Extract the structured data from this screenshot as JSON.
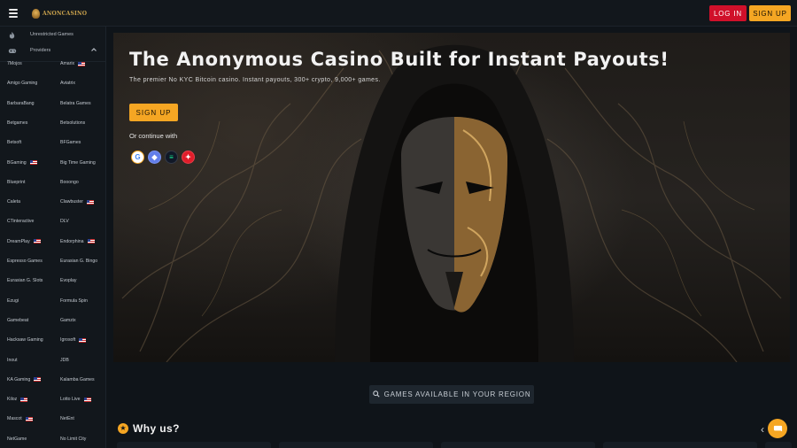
{
  "header": {
    "logo_text": "ANONCASINO",
    "login_label": "LOG IN",
    "signup_label": "SIGN UP"
  },
  "sidebar": {
    "unrestricted_label": "Unrestricted Games",
    "providers_label": "Providers",
    "providers": [
      {
        "name": "7Mojos",
        "flag": false
      },
      {
        "name": "Amarix",
        "flag": true
      },
      {
        "name": "Amigo Gaming",
        "flag": false
      },
      {
        "name": "Aviatrix",
        "flag": false
      },
      {
        "name": "BarbaraBang",
        "flag": false
      },
      {
        "name": "Belatra Games",
        "flag": false
      },
      {
        "name": "Betgames",
        "flag": false
      },
      {
        "name": "Betsolutions",
        "flag": false
      },
      {
        "name": "Betsoft",
        "flag": false
      },
      {
        "name": "BFGames",
        "flag": false
      },
      {
        "name": "BGaming",
        "flag": true
      },
      {
        "name": "Big Time Gaming",
        "flag": false
      },
      {
        "name": "Blueprint",
        "flag": false
      },
      {
        "name": "Booongo",
        "flag": false
      },
      {
        "name": "Caleta",
        "flag": false
      },
      {
        "name": "Clawbuster",
        "flag": true
      },
      {
        "name": "CTinteractive",
        "flag": false
      },
      {
        "name": "DLV",
        "flag": false
      },
      {
        "name": "DreamPlay",
        "flag": true
      },
      {
        "name": "Endorphina",
        "flag": true
      },
      {
        "name": "Espresso Games",
        "flag": false
      },
      {
        "name": "Eurasian G. Bingo",
        "flag": false
      },
      {
        "name": "Eurasian G. Slots",
        "flag": false
      },
      {
        "name": "Evoplay",
        "flag": false
      },
      {
        "name": "Ezugi",
        "flag": false
      },
      {
        "name": "Formula Spin",
        "flag": false
      },
      {
        "name": "Gamebeat",
        "flag": false
      },
      {
        "name": "Gamzix",
        "flag": false
      },
      {
        "name": "Hacksaw Gaming",
        "flag": false
      },
      {
        "name": "Igrosoft",
        "flag": true
      },
      {
        "name": "Inout",
        "flag": false
      },
      {
        "name": "JDB",
        "flag": false
      },
      {
        "name": "KA Gaming",
        "flag": true
      },
      {
        "name": "Kalamba Games",
        "flag": false
      },
      {
        "name": "Kiloz",
        "flag": true
      },
      {
        "name": "Lotto Live",
        "flag": true
      },
      {
        "name": "Mascot",
        "flag": true
      },
      {
        "name": "NetEnt",
        "flag": false
      },
      {
        "name": "NetGame",
        "flag": false
      },
      {
        "name": "No Limit City",
        "flag": false
      }
    ]
  },
  "hero": {
    "title": "The Anonymous Casino Built for Instant Payouts!",
    "subtitle": "The premier No KYC Bitcoin casino. Instant payouts, 300+ crypto, 9,000+ games.",
    "signup_label": "SIGN UP",
    "continue_label": "Or continue with",
    "social": [
      {
        "name": "google",
        "glyph": "G",
        "bg": "#ffffff",
        "fg": "#4285f4"
      },
      {
        "name": "ethereum",
        "glyph": "◆",
        "bg": "#627eea",
        "fg": "#ffffff"
      },
      {
        "name": "solana",
        "glyph": "≡",
        "bg": "#111827",
        "fg": "#14f195"
      },
      {
        "name": "other",
        "glyph": "✦",
        "bg": "#e11d2a",
        "fg": "#ffffff"
      }
    ]
  },
  "region_button": "GAMES AVAILABLE IN YOUR REGION",
  "why_title": "Why us?",
  "colors": {
    "accent": "#f5a623",
    "login": "#d0102a",
    "bg": "#0f1419"
  }
}
